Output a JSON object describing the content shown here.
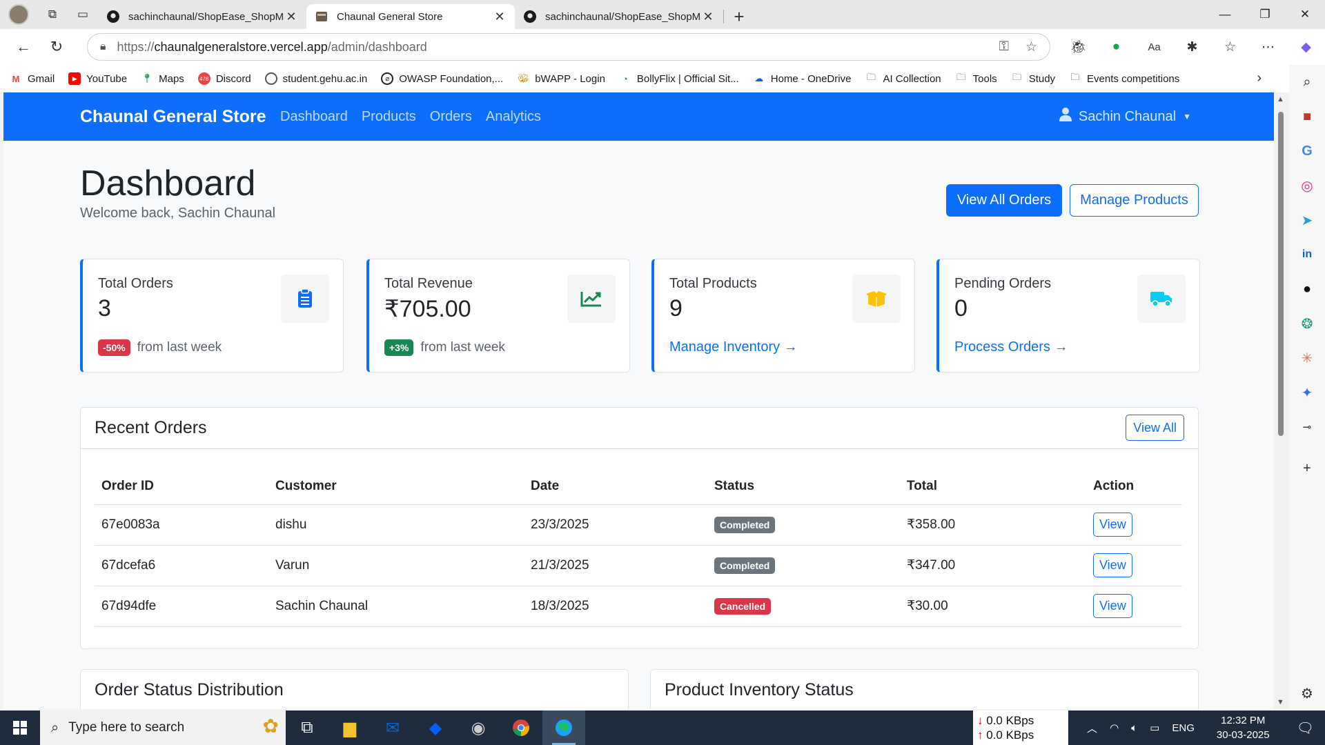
{
  "browser": {
    "tabs": [
      {
        "title": "sachinchaunal/ShopEase_ShopMa",
        "close": "✕"
      },
      {
        "title": "Chaunal General Store",
        "close": "✕"
      },
      {
        "title": "sachinchaunal/ShopEase_ShopMa",
        "close": "✕"
      }
    ],
    "url_prefix": "https://",
    "url_host": "chaunalgeneralstore.vercel.app",
    "url_path": "/admin/dashboard",
    "bookmarks": [
      {
        "label": "Gmail",
        "icon": "gmail-icon"
      },
      {
        "label": "YouTube",
        "icon": "youtube-icon"
      },
      {
        "label": "Maps",
        "icon": "maps-icon"
      },
      {
        "label": "Discord",
        "icon": "discord-icon"
      },
      {
        "label": "student.gehu.ac.in",
        "icon": "gehu-icon"
      },
      {
        "label": "OWASP Foundation,...",
        "icon": "owasp-icon"
      },
      {
        "label": "bWAPP - Login",
        "icon": "bee-icon"
      },
      {
        "label": "BollyFlix | Official Sit...",
        "icon": "bollyflix-icon"
      },
      {
        "label": "Home - OneDrive",
        "icon": "onedrive-icon"
      },
      {
        "label": "AI Collection",
        "icon": "folder-icon"
      },
      {
        "label": "Tools",
        "icon": "folder-icon"
      },
      {
        "label": "Study",
        "icon": "folder-icon"
      },
      {
        "label": "Events competitions",
        "icon": "folder-icon"
      }
    ]
  },
  "navbar": {
    "brand": "Chaunal General Store",
    "links": [
      "Dashboard",
      "Products",
      "Orders",
      "Analytics"
    ],
    "user": "Sachin Chaunal"
  },
  "header": {
    "title": "Dashboard",
    "subtitle": "Welcome back, Sachin Chaunal",
    "btn_orders": "View All Orders",
    "btn_products": "Manage Products"
  },
  "stats": [
    {
      "label": "Total Orders",
      "value": "3",
      "badge": "-50%",
      "badge_color": "#dc3545",
      "foot": "from last week",
      "icon": "clipboard-icon",
      "accent": "#0d6efd"
    },
    {
      "label": "Total Revenue",
      "value": "₹705.00",
      "badge": "+3%",
      "badge_color": "#198754",
      "foot": "from last week",
      "icon": "chart-line-icon",
      "accent": "#198754"
    },
    {
      "label": "Total Products",
      "value": "9",
      "link": "Manage Inventory →",
      "icon": "box-icon",
      "accent": "#ffc107"
    },
    {
      "label": "Pending Orders",
      "value": "0",
      "link": "Process Orders →",
      "icon": "truck-icon",
      "accent": "#0dcaf0"
    }
  ],
  "recent_orders": {
    "title": "Recent Orders",
    "view_all": "View All",
    "columns": [
      "Order ID",
      "Customer",
      "Date",
      "Status",
      "Total",
      "Action"
    ],
    "rows": [
      {
        "id": "67e0083a",
        "customer": "dishu",
        "date": "23/3/2025",
        "status": "Completed",
        "status_color": "#6c757d",
        "total": "₹358.00",
        "action": "View"
      },
      {
        "id": "67dcefa6",
        "customer": "Varun",
        "date": "21/3/2025",
        "status": "Completed",
        "status_color": "#6c757d",
        "total": "₹347.00",
        "action": "View"
      },
      {
        "id": "67d94dfe",
        "customer": "Sachin Chaunal",
        "date": "18/3/2025",
        "status": "Cancelled",
        "status_color": "#dc3545",
        "total": "₹30.00",
        "action": "View"
      }
    ]
  },
  "sections": {
    "order_status": "Order Status Distribution",
    "inventory": "Product Inventory Status"
  },
  "taskbar": {
    "search_placeholder": "Type here to search",
    "net_down": "0.0 KBps",
    "net_up": "0.0 KBps",
    "lang": "ENG",
    "time": "12:32 PM",
    "date": "30-03-2025"
  }
}
